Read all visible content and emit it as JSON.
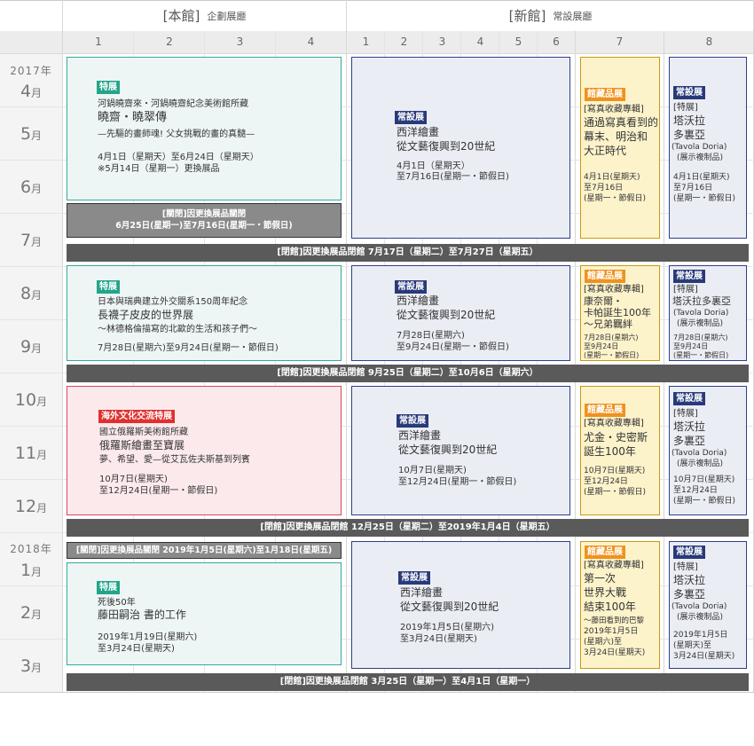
{
  "header": {
    "main_name": "[本館]",
    "main_sub": "企劃展廳",
    "new_name": "[新館]",
    "new_sub": "常設展廳"
  },
  "columns": [
    "1",
    "2",
    "3",
    "4",
    "1",
    "2",
    "3",
    "4",
    "5",
    "6",
    "7",
    "8"
  ],
  "years": {
    "y2017": "2017年",
    "y2018": "2018年"
  },
  "months": [
    "4",
    "5",
    "6",
    "7",
    "8",
    "9",
    "10",
    "11",
    "12",
    "1",
    "2",
    "3"
  ],
  "month_suffix": "月",
  "p1": {
    "special": {
      "tag": "特展",
      "line1": "河鍋曉齋來・河鍋曉齋紀念美術館所藏",
      "title": "曉齋・曉翠傳",
      "sub": "—先驅的畫師魂! 父女挑戰的畫的真髓—",
      "date1": "4月1日（星期天）至6月24日（星期天）",
      "date2": "※5月14日（星期一）更換展品"
    },
    "gray": {
      "l1": "[關閉]因更換展品關閉",
      "l2": "6月25日(星期一)至7月16日(星期一・節假日)"
    },
    "perm": {
      "tag": "常設展",
      "l1": "西洋繪畫",
      "l2": "從文藝復興到20世紀",
      "d1": "4月1日（星期天）",
      "d2": "至7月16日(星期一・節假日)"
    },
    "col7": {
      "tag": "館藏品展",
      "l0": "[寫真收藏專輯]",
      "l1": "通過寫真看到的",
      "l2": "幕末、明治和",
      "l3": "大正時代",
      "d1": "4月1日(星期天)",
      "d2": "至7月16日",
      "d3": "(星期一・節假日)"
    },
    "col8": {
      "tag": "常設展",
      "l0": "[特展]",
      "l1": "塔沃拉",
      "l2": "多裏亞",
      "l3": "(Tavola Doria)",
      "l4": "(展示複制品)",
      "d1": "4月1日(星期天)",
      "d2": "至7月16日",
      "d3": "(星期一・節假日)"
    },
    "bar": "[閉館]因更換展品閉館 7月17日（星期二）至7月27日（星期五）"
  },
  "p2": {
    "special": {
      "tag": "特展",
      "line1": "日本與瑞典建立外交關系150周年紀念",
      "title": "長襪子皮皮的世界展",
      "sub": "～林德格倫描寫的北歐的生活和孩子們～",
      "date1": "7月28日(星期六)至9月24日(星期一・節假日)"
    },
    "perm": {
      "tag": "常設展",
      "l1": "西洋繪畫",
      "l2": "從文藝復興到20世紀",
      "d1": "7月28日(星期六)",
      "d2": "至9月24日(星期一・節假日)"
    },
    "col7": {
      "tag": "館藏品展",
      "l0": "[寫真收藏專輯]",
      "l1": "康奈爾・",
      "l2": "卡帕誕生100年",
      "l3": "〜兄弟羈絆",
      "d1": "7月28日(星期六)",
      "d2": "至9月24日",
      "d3": "(星期一・節假日)"
    },
    "col8": {
      "tag": "常設展",
      "l0": "[特展]",
      "l1": "塔沃拉多裏亞",
      "l3": "(Tavola Doria)",
      "l4": "(展示複制品)",
      "d1": "7月28日(星期六)",
      "d2": "至9月24日",
      "d3": "(星期一・節假日)"
    },
    "bar": "[閉館]因更換展品閉館 9月25日（星期二）至10月6日（星期六）"
  },
  "p3": {
    "special": {
      "tag": "海外文化交流特展",
      "line1": "國立俄羅斯美術館所藏",
      "title": "俄羅斯繪畫至寶展",
      "sub": "夢、希望、愛—從艾瓦佐夫斯基到列賓",
      "date1": "10月7日(星期天)",
      "date2": "至12月24日(星期一・節假日)"
    },
    "perm": {
      "tag": "常設展",
      "l1": "西洋繪畫",
      "l2": "從文藝復興到20世紀",
      "d1": "10月7日(星期天)",
      "d2": "至12月24日(星期一・節假日)"
    },
    "col7": {
      "tag": "館藏品展",
      "l0": "[寫真收藏專輯]",
      "l1": "尤金・史密斯",
      "l2": "誕生100年",
      "d1": "10月7日(星期天)",
      "d2": "至12月24日",
      "d3": "(星期一・節假日)"
    },
    "col8": {
      "tag": "常設展",
      "l0": "[特展]",
      "l1": "塔沃拉",
      "l2": "多裏亞",
      "l3": "(Tavola Doria)",
      "l4": "(展示複制品)",
      "d1": "10月7日(星期天)",
      "d2": "至12月24日",
      "d3": "(星期一・節假日)"
    },
    "bar": "[閉館]因更換展品閉館 12月25日（星期二）至2019年1月4日（星期五）"
  },
  "p4": {
    "gray": {
      "l1": "[關閉]因更換展品關閉 2019年1月5日(星期六)至1月18日(星期五)"
    },
    "special": {
      "tag": "特展",
      "line1": "死後50年",
      "title": "藤田嗣治 書的工作",
      "date1": "2019年1月19日(星期六)",
      "date2": "至3月24日(星期天)"
    },
    "perm": {
      "tag": "常設展",
      "l1": "西洋繪畫",
      "l2": "從文藝復興到20世紀",
      "d1": "2019年1月5日(星期六)",
      "d2": "至3月24日(星期天)"
    },
    "col7": {
      "tag": "館藏品展",
      "l0": "[寫真收藏專輯]",
      "l1": "第一次",
      "l2": "世界大戰",
      "l3": "結束100年",
      "l4": "〜藤田看到的巴黎",
      "d1": "2019年1月5日",
      "d2": "(星期六)至",
      "d3": "3月24日(星期天)"
    },
    "col8": {
      "tag": "常設展",
      "l0": "[特展]",
      "l1": "塔沃拉",
      "l2": "多裏亞",
      "l3": "(Tavola Doria)",
      "l4": "(展示複制品)",
      "d1": "2019年1月5日",
      "d2": "(星期天)至",
      "d3": "3月24日(星期天)"
    },
    "bar": "[閉館]因更換展品閉館 3月25日（星期一）至4月1日（星期一）"
  }
}
